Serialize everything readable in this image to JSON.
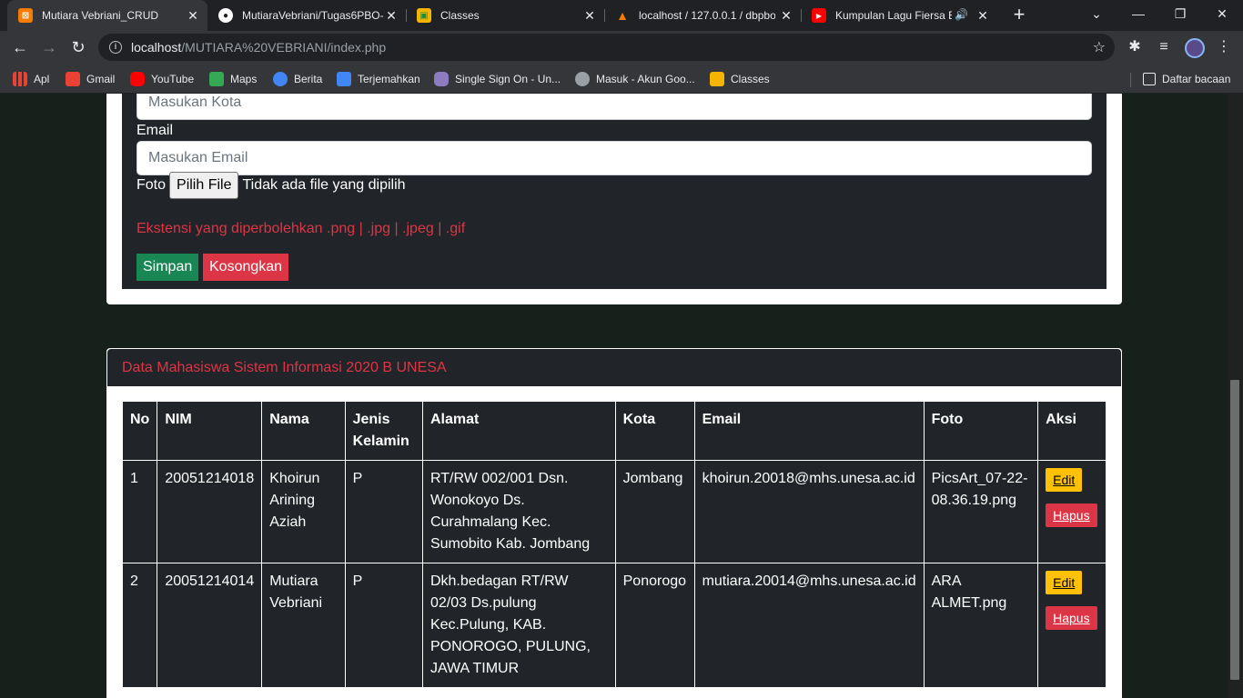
{
  "browser": {
    "tabs": [
      {
        "title": "Mutiara Vebriani_CRUD",
        "favicon_color": "#f57c00",
        "favicon_char": "⊠",
        "active": true
      },
      {
        "title": "MutiaraVebriani/Tugas6PBO-",
        "favicon_color": "#ffffff",
        "favicon_char": "●",
        "active": false
      },
      {
        "title": "Classes",
        "favicon_color": "#f4b400",
        "favicon_char": "▣",
        "active": false
      },
      {
        "title": "localhost / 127.0.0.1 / dbpbo",
        "favicon_color": "#f57c00",
        "favicon_char": "▲",
        "active": false
      },
      {
        "title": "Kumpulan Lagu Fiersa Be",
        "favicon_color": "#ff0000",
        "favicon_char": "▶",
        "active": false
      }
    ],
    "url_host": "localhost",
    "url_path": "/MUTIARA%20VEBRIANI/index.php",
    "bookmarks": [
      {
        "label": "Apl",
        "color": "#ea4335"
      },
      {
        "label": "Gmail",
        "color": "#ea4335"
      },
      {
        "label": "YouTube",
        "color": "#ff0000"
      },
      {
        "label": "Maps",
        "color": "#34a853"
      },
      {
        "label": "Berita",
        "color": "#4285f4"
      },
      {
        "label": "Terjemahkan",
        "color": "#4285f4"
      },
      {
        "label": "Single Sign On - Un...",
        "color": "#8e7cc3"
      },
      {
        "label": "Masuk - Akun Goo...",
        "color": "#9aa0a6"
      },
      {
        "label": "Classes",
        "color": "#f4b400"
      }
    ],
    "reading_list": "Daftar bacaan"
  },
  "form": {
    "kota_placeholder": "Masukan Kota",
    "email_label": "Email",
    "email_placeholder": "Masukan Email",
    "foto_label": "Foto",
    "file_button": "Pilih File",
    "file_status": "Tidak ada file yang dipilih",
    "ext_hint": "Ekstensi yang diperbolehkan .png | .jpg | .jpeg | .gif",
    "save_label": "Simpan",
    "clear_label": "Kosongkan"
  },
  "table_card": {
    "title": "Data Mahasiswa Sistem Informasi 2020 B UNESA",
    "columns": [
      "No",
      "NIM",
      "Nama",
      "Jenis Kelamin",
      "Alamat",
      "Kota",
      "Email",
      "Foto",
      "Aksi"
    ],
    "rows": [
      {
        "no": "1",
        "nim": "20051214018",
        "nama": "Khoirun Arining Aziah",
        "jk": "P",
        "alamat": "RT/RW 002/001 Dsn. Wonokoyo Ds. Curahmalang Kec. Sumobito Kab. Jombang",
        "kota": "Jombang",
        "email": "khoirun.20018@mhs.unesa.ac.id",
        "foto": "PicsArt_07-22-08.36.19.png"
      },
      {
        "no": "2",
        "nim": "20051214014",
        "nama": "Mutiara Vebriani",
        "jk": "P",
        "alamat": "Dkh.bedagan RT/RW 02/03 Ds.pulung Kec.Pulung, KAB. PONOROGO, PULUNG, JAWA TIMUR",
        "kota": "Ponorogo",
        "email": "mutiara.20014@mhs.unesa.ac.id",
        "foto": "ARA ALMET.png"
      }
    ],
    "edit_label": "Edit",
    "delete_label": "Hapus"
  }
}
